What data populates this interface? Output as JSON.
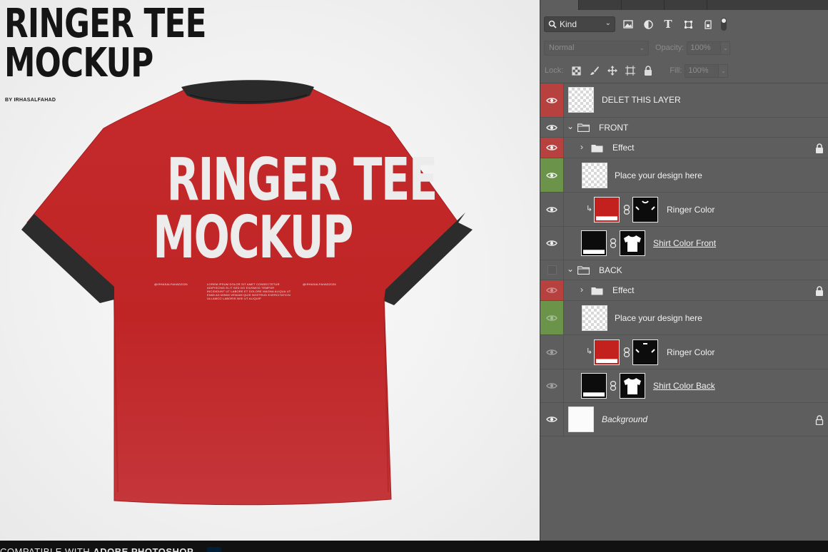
{
  "preview": {
    "title_line1": "RINGER TEE",
    "title_line2": "MOCKUP",
    "byline": "BY IRHASALFAHAD",
    "shirt_text_line1": "RINGER TEE",
    "shirt_text_line2": "MOCKUP",
    "shirt_small_left": "@IRHASALFAHAD2026",
    "shirt_small_center": "LOREM IPSUM DOLOR SIT AMET CONSECTETUR ADIPISCING ELIT SED DO EIUSMOD TEMPOR INCIDIDUNT UT LABORE ET DOLORE MAGNA ALIQUA UT ENIM AD MINIM VENIAM QUIS NOSTRUD EXERCITATION ULLAMCO LABORIS NISI UT ALIQUIP",
    "shirt_small_right": "@IRHASALFAHAD2026",
    "colors": {
      "shirt_red": "#c0282a",
      "ringer_black": "#2b2b2b"
    }
  },
  "footer": {
    "prefix": "COMPATIBLE WITH ",
    "app": "ADOBE PHOTOSHOP"
  },
  "panel": {
    "filter": {
      "kind_label": "Kind",
      "icons": [
        "image-filter-icon",
        "adjustment-filter-icon",
        "type-filter-icon",
        "shape-filter-icon",
        "smart-object-filter-icon"
      ]
    },
    "blend_mode": "Normal",
    "opacity_label": "Opacity:",
    "opacity_value": "100%",
    "locks_label": "Lock:",
    "fill_label": "Fill:",
    "fill_value": "100%",
    "layers": [
      {
        "name": "DELET THIS LAYER",
        "visible": true,
        "eye_color": "red"
      },
      {
        "name": "FRONT",
        "type": "group",
        "expanded": true,
        "visible": true
      },
      {
        "name": "Effect",
        "type": "group",
        "expanded": false,
        "locked": true,
        "eye_color": "red"
      },
      {
        "name": "Place your design here",
        "type": "smart-object",
        "eye_color": "green"
      },
      {
        "name": "Ringer Color",
        "clipped": true,
        "mask": true
      },
      {
        "name": "Shirt Color Front",
        "mask": true
      },
      {
        "name": "BACK",
        "type": "group",
        "expanded": true,
        "visible": false
      },
      {
        "name": "Effect",
        "type": "group",
        "expanded": false,
        "locked": true,
        "eye_color": "red"
      },
      {
        "name": "Place your design here",
        "type": "smart-object",
        "eye_color": "green"
      },
      {
        "name": "Ringer Color",
        "clipped": true,
        "mask": true
      },
      {
        "name": "Shirt Color Back",
        "mask": true
      },
      {
        "name": "Background",
        "locked": true
      }
    ]
  }
}
